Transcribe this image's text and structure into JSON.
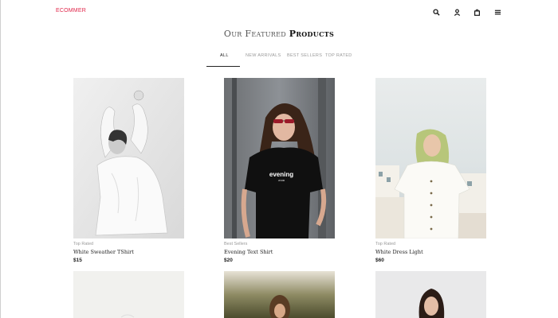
{
  "header": {
    "logo": "ECOMMER",
    "icons": [
      "search-icon",
      "user-icon",
      "bag-icon",
      "menu-icon"
    ]
  },
  "section": {
    "title_light": "Our Featured",
    "title_strong": "Products"
  },
  "tabs": [
    {
      "label": "ALL",
      "active": true
    },
    {
      "label": "NEW ARRIVALS",
      "active": false
    },
    {
      "label": "BEST SELLERS",
      "active": false
    },
    {
      "label": "TOP RATED",
      "active": false
    }
  ],
  "products": [
    {
      "category": "Top Rated",
      "name": "White Sweather TShirt",
      "price": "$15"
    },
    {
      "category": "Best Sellers",
      "name": "Evening Text Shirt",
      "price": "$20"
    },
    {
      "category": "Top Rated",
      "name": "White Dress Light",
      "price": "$60"
    }
  ],
  "shirt_print": {
    "line1": "evening",
    "line2": "JOUR"
  },
  "colors": {
    "accent": "#e0264a",
    "text": "#222222",
    "muted": "#999999"
  }
}
